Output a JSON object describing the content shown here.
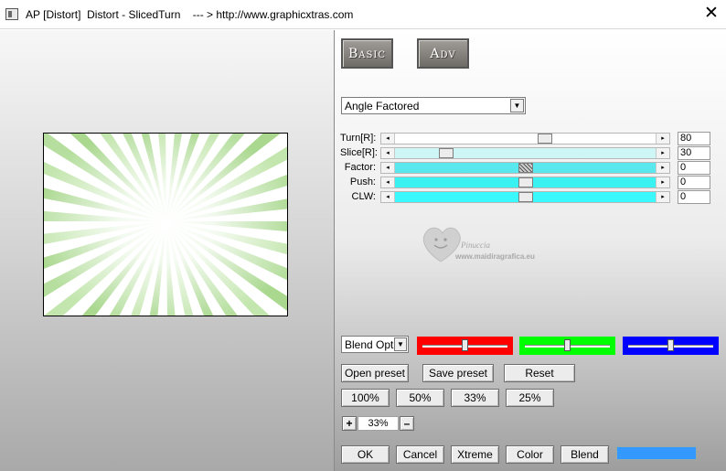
{
  "window": {
    "title": "AP [Distort]  Distort - SlicedTurn    --- > http://www.graphicxtras.com",
    "close_glyph": "✕"
  },
  "tabs": [
    {
      "label": "Basic"
    },
    {
      "label": "Adv"
    }
  ],
  "mode_select": {
    "value": "Angle Factored"
  },
  "params": [
    {
      "label": "Turn[R]:",
      "value": "80",
      "thumb": 0.58,
      "track_color": "#ffffff"
    },
    {
      "label": "Slice[R]:",
      "value": "30",
      "thumb": 0.18,
      "track_color": "#cff6f6"
    },
    {
      "label": "Factor:",
      "value": "0",
      "thumb": 0.5,
      "track_color": "#58e8ee"
    },
    {
      "label": "Push:",
      "value": "0",
      "thumb": 0.5,
      "track_color": "#3af2f2"
    },
    {
      "label": "CLW:",
      "value": "0",
      "thumb": 0.5,
      "track_color": "#3af8fb"
    }
  ],
  "watermark": {
    "name": "Pinuccia",
    "site": "www.maidiragrafica.eu"
  },
  "blend": {
    "select_value": "Blend Options",
    "red": {
      "value": 0.5,
      "color": "#ff0000"
    },
    "green": {
      "value": 0.5,
      "color": "#00ff00"
    },
    "blue": {
      "value": 0.5,
      "color": "#0000ff"
    }
  },
  "preset_buttons": {
    "open": "Open preset",
    "save": "Save preset",
    "reset": "Reset"
  },
  "zoom_buttons": [
    "100%",
    "50%",
    "33%",
    "25%"
  ],
  "zoom": {
    "plus": "+",
    "value": "33%",
    "minus": "–"
  },
  "bottom_buttons": {
    "ok": "OK",
    "cancel": "Cancel",
    "xtreme": "Xtreme",
    "color": "Color",
    "blend": "Blend"
  },
  "blend_color": "#3399ff"
}
